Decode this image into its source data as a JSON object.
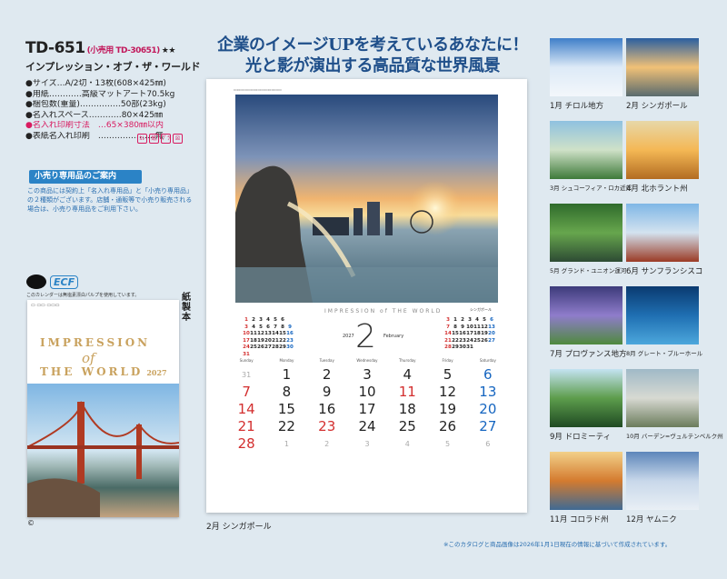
{
  "product": {
    "code": "TD-651",
    "small_lot": "(小売用 TD-30651)",
    "stars": "★★",
    "name": "インプレッション・オブ・ザ・ワールド"
  },
  "specs": [
    "●サイズ…A/2切・13枚(608×425㎜)",
    "●用紙…………高級マットアート70.5kg",
    "●梱包数(重量)……………50部(23kg)",
    "●名入れスペース…………80×425㎜",
    "●名入れ印刷寸法　…65×380㎜以内",
    "●表紙名入れ印刷　…………………無"
  ],
  "badges": [
    "ｶﾚ",
    "紙",
    "ﾌﾟﾗ",
    "☒"
  ],
  "notice": {
    "title": "小売り専用品のご案内",
    "text": "この商品には契約上「名入れ専用品」と「小売り専用品」の２種類がございます。店舗・通販等で小売り販売される場合は、小売り専用品をご利用下さい。"
  },
  "ecf": {
    "logo": "ECF",
    "note": "このカレンダーは無塩素漂白パルプを使用しています。"
  },
  "paper_label": "紙製本",
  "mini_calendar": {
    "line1": "IMPRESSION",
    "line2": "of",
    "line3": "THE WORLD",
    "year": "2027"
  },
  "copyright": "©",
  "headline": {
    "line1": "企業のイメージUPを考えているあなたに！",
    "line2": "光と影が演出する高品質な世界風景"
  },
  "main_calendar": {
    "series": "IMPRESSION of THE WORLD",
    "month_number": "2",
    "year": "2027",
    "month_name": "February",
    "caption": "シンガポール",
    "weekdays": [
      "Sunday",
      "Monday",
      "Tuesday",
      "Wednesday",
      "Thursday",
      "Friday",
      "Saturday"
    ],
    "prev_month": [
      [
        "1",
        "2",
        "3",
        "4",
        "5",
        "6"
      ],
      [
        "3",
        "4",
        "5",
        "6",
        "7",
        "8",
        "9"
      ],
      [
        "10",
        "11",
        "12",
        "13",
        "14",
        "15",
        "16"
      ],
      [
        "17",
        "18",
        "19",
        "20",
        "21",
        "22",
        "23"
      ],
      [
        "24",
        "25",
        "26",
        "27",
        "28",
        "29",
        "30"
      ],
      [
        "31"
      ]
    ],
    "next_month": [
      [
        "3",
        "1",
        "2",
        "3",
        "4",
        "5",
        "6"
      ],
      [
        "7",
        "8",
        "9",
        "10",
        "11",
        "12",
        "13"
      ],
      [
        "14",
        "15",
        "16",
        "17",
        "18",
        "19",
        "20"
      ],
      [
        "21",
        "22",
        "23",
        "24",
        "25",
        "26",
        "27"
      ],
      [
        "28",
        "29",
        "30",
        "31"
      ]
    ],
    "weeks": [
      [
        "31",
        "1",
        "2",
        "3",
        "4",
        "5",
        "6"
      ],
      [
        "7",
        "8",
        "9",
        "10",
        "11",
        "12",
        "13"
      ],
      [
        "14",
        "15",
        "16",
        "17",
        "18",
        "19",
        "20"
      ],
      [
        "21",
        "22",
        "23",
        "24",
        "25",
        "26",
        "27"
      ],
      [
        "28",
        "1",
        "2",
        "3",
        "4",
        "5",
        "6"
      ]
    ],
    "label": "2月 シンガポール"
  },
  "thumbnails": [
    {
      "label": "1月 チロル地方"
    },
    {
      "label": "2月 シンガポール"
    },
    {
      "label": "3月 シュコーフィア・ロカ近郊"
    },
    {
      "label": "4月 北ホラント州"
    },
    {
      "label": "5月 グランド・ユニオン運河"
    },
    {
      "label": "6月 サンフランシスコ"
    },
    {
      "label": "7月 プロヴァンス地方"
    },
    {
      "label": "8月 グレート・ブルーホール"
    },
    {
      "label": "9月 ドロミーティ"
    },
    {
      "label": "10月 バーデン=ヴュルテンベルク州"
    },
    {
      "label": "11月 コロラド州"
    },
    {
      "label": "12月 ヤムニク"
    }
  ],
  "footnote": "※このカタログと商品画像は2026年1月1日現在の情報に基づいて作成されています。"
}
